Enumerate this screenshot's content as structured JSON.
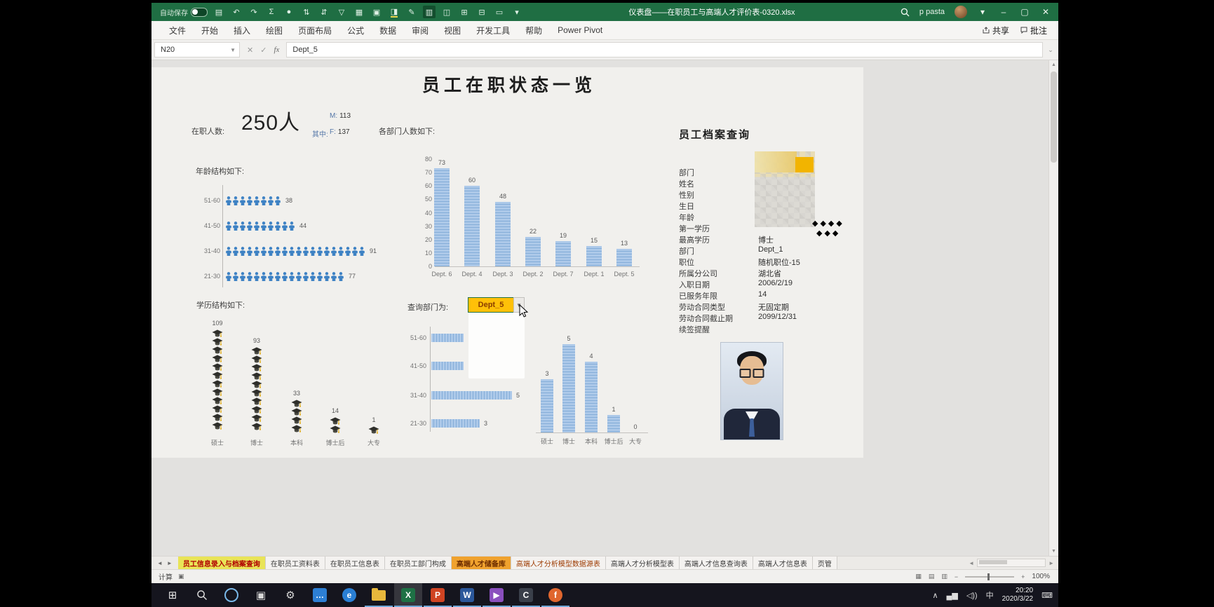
{
  "window": {
    "autosave_label": "自动保存",
    "title": "仪表盘——在职员工与高端人才评价表-0320.xlsx",
    "user": "p pasta",
    "minimize": "–",
    "maximize": "▢",
    "close": "✕",
    "qat_icons": [
      {
        "name": "save-icon",
        "glyph": "▤"
      },
      {
        "name": "undo-icon",
        "glyph": "↶"
      },
      {
        "name": "redo-icon",
        "glyph": "↷"
      },
      {
        "name": "autosum-icon",
        "glyph": "Σ"
      },
      {
        "name": "fill-circle-icon",
        "glyph": "●"
      },
      {
        "name": "sort-asc-icon",
        "glyph": "⇅"
      },
      {
        "name": "sort-desc-icon",
        "glyph": "⇵"
      },
      {
        "name": "filter-icon",
        "glyph": "▽"
      },
      {
        "name": "borders-icon",
        "glyph": "▦"
      },
      {
        "name": "merge-cells-icon",
        "glyph": "▣"
      },
      {
        "name": "fill-color-icon",
        "glyph": "◨"
      },
      {
        "name": "format-painter-icon",
        "glyph": "✎"
      },
      {
        "name": "gridlines-toggle-icon",
        "glyph": "▥",
        "active": true
      },
      {
        "name": "freeze-panes-icon",
        "glyph": "◫"
      },
      {
        "name": "new-window-icon",
        "glyph": "⊞"
      },
      {
        "name": "arrange-windows-icon",
        "glyph": "⊟"
      },
      {
        "name": "switch-window-icon",
        "glyph": "▭"
      },
      {
        "name": "qat-customize-icon",
        "glyph": "▾"
      }
    ]
  },
  "ribbon": {
    "tabs": [
      "文件",
      "开始",
      "插入",
      "绘图",
      "页面布局",
      "公式",
      "数据",
      "审阅",
      "视图",
      "开发工具",
      "帮助",
      "Power Pivot"
    ],
    "share_label": "共享",
    "comments_label": "批注"
  },
  "formula_bar": {
    "name_box": "N20",
    "cancel": "✕",
    "enter": "✓",
    "fx": "fx",
    "value": "Dept_5"
  },
  "dashboard": {
    "title": "员工在职状态一览",
    "headcount_label": "在职人数:",
    "headcount_value": "250人",
    "among_label": "其中:",
    "male_label": "M:",
    "male_value": "113",
    "female_label": "F:",
    "female_value": "137",
    "query_label": "查询部门为:",
    "query_value": "Dept_5",
    "profile": {
      "title": "员工档案查询",
      "fields": [
        {
          "label": "部门",
          "value": "",
          "masked": true
        },
        {
          "label": "姓名",
          "value": "",
          "masked": true
        },
        {
          "label": "性别",
          "value": "",
          "masked": true
        },
        {
          "label": "生日",
          "value": "",
          "masked": true
        },
        {
          "label": "年龄",
          "value": "",
          "masked": true
        },
        {
          "label": "第一学历",
          "value": "",
          "masked": true
        },
        {
          "label": "最高学历",
          "value": "博士",
          "masked": false
        },
        {
          "label": "部门",
          "value": "Dept_1",
          "masked": false
        },
        {
          "label": "职位",
          "value": "随机职位-15",
          "masked": false
        },
        {
          "label": "所属分公司",
          "value": "湖北省",
          "masked": false
        },
        {
          "label": "入职日期",
          "value": "2006/2/19",
          "masked": false
        },
        {
          "label": "已服务年限",
          "value": "14",
          "masked": false
        },
        {
          "label": "劳动合同类型",
          "value": "无固定期",
          "masked": false
        },
        {
          "label": "劳动合同截止期",
          "value": "2099/12/31",
          "masked": false
        },
        {
          "label": "续签提醒",
          "value": "",
          "masked": false
        }
      ]
    }
  },
  "chart_data": [
    {
      "id": "age_structure",
      "type": "pictogram-bar",
      "orientation": "horizontal",
      "title": "年龄结构如下:",
      "icon": "person-icon",
      "people_per_icon": 4.55,
      "categories": [
        "51-60",
        "41-50",
        "31-40",
        "21-30"
      ],
      "values": [
        38,
        44,
        91,
        77
      ],
      "color": "#3e82c4"
    },
    {
      "id": "dept_headcount",
      "type": "bar",
      "title": "各部门人数如下:",
      "categories": [
        "Dept. 6",
        "Dept. 4",
        "Dept. 3",
        "Dept. 2",
        "Dept. 7",
        "Dept. 1",
        "Dept. 5"
      ],
      "values": [
        73,
        60,
        48,
        22,
        19,
        15,
        13
      ],
      "ylim": [
        0,
        80
      ],
      "ytick_step": 10,
      "grid": false,
      "legend": false
    },
    {
      "id": "edu_structure",
      "type": "pictogram-column",
      "title": "学历结构如下:",
      "icon": "graduation-cap-icon",
      "units_per_icon": 9.3,
      "categories": [
        "硕士",
        "博士",
        "本科",
        "博士后",
        "大专"
      ],
      "values": [
        109,
        93,
        33,
        14,
        1
      ]
    },
    {
      "id": "query_dept_age",
      "type": "bar",
      "orientation": "horizontal",
      "categories": [
        "51-60",
        "41-50",
        "31-40",
        "21-30"
      ],
      "values": [
        2,
        2,
        5,
        3
      ],
      "value_labels_visible": [
        false,
        false,
        true,
        true
      ],
      "note": "values for 51-60 and 41-50 hidden behind white overlay"
    },
    {
      "id": "query_dept_edu",
      "type": "bar",
      "categories": [
        "硕士",
        "博士",
        "本科",
        "博士后",
        "大专"
      ],
      "values": [
        3,
        5,
        4,
        1,
        0
      ]
    }
  ],
  "decor": {
    "diamonds_row1": "◆◆◆◆",
    "diamonds_row2": "◆◆◆"
  },
  "sheet_tabs": {
    "nav_left": "◄",
    "nav_right": "►",
    "tabs": [
      {
        "label": "员工信息录入与档案查询",
        "style": "yellow"
      },
      {
        "label": "在职员工资料表",
        "style": ""
      },
      {
        "label": "在职员工信息表",
        "style": ""
      },
      {
        "label": "在职员工部门构成",
        "style": ""
      },
      {
        "label": "高端人才储备库",
        "style": "orange"
      },
      {
        "label": "高端人才分析模型数据源表",
        "style": "redtext"
      },
      {
        "label": "高端人才分析模型表",
        "style": ""
      },
      {
        "label": "高端人才信息查询表",
        "style": ""
      },
      {
        "label": "高端人才信息表",
        "style": ""
      },
      {
        "label": "页管",
        "style": ""
      }
    ]
  },
  "status_bar": {
    "mode": "计算",
    "zoom": "100%",
    "zoom_minus": "−",
    "zoom_plus": "+"
  },
  "taskbar": {
    "clock_time": "20:20",
    "clock_date": "2020/3/22",
    "tray_ime": "中",
    "icons": [
      {
        "name": "start-button",
        "kind": "glyph",
        "glyph": "⊞",
        "color": "#e8e8e8"
      },
      {
        "name": "search-icon",
        "kind": "search"
      },
      {
        "name": "cortana-icon",
        "kind": "ring",
        "color": "#7ab8e8"
      },
      {
        "name": "task-view-icon",
        "kind": "glyph",
        "glyph": "▣",
        "color": "#d8d8d8"
      },
      {
        "name": "settings-icon",
        "kind": "glyph",
        "glyph": "⚙",
        "color": "#d8d8d8"
      },
      {
        "name": "chat-icon",
        "kind": "sq",
        "glyph": "…",
        "bg": "#2d7fd4"
      },
      {
        "name": "edge-icon",
        "kind": "circ",
        "glyph": "e",
        "bg": "#2a7fd4"
      },
      {
        "name": "file-explorer-icon",
        "kind": "folder",
        "open": true
      },
      {
        "name": "excel-icon",
        "kind": "sq",
        "glyph": "X",
        "bg": "#1e7145",
        "open": true,
        "active": true
      },
      {
        "name": "powerpoint-icon",
        "kind": "sq",
        "glyph": "P",
        "bg": "#d04423",
        "open": true
      },
      {
        "name": "word-icon",
        "kind": "sq",
        "glyph": "W",
        "bg": "#2b579a",
        "open": true
      },
      {
        "name": "media-player-icon",
        "kind": "sq",
        "glyph": "▶",
        "bg": "#8a4fbe",
        "open": true
      },
      {
        "name": "c-app-icon",
        "kind": "sq",
        "glyph": "C",
        "bg": "#3a3f4a",
        "open": true
      },
      {
        "name": "firefox-icon",
        "kind": "circ",
        "glyph": "f",
        "bg": "#e0662e",
        "open": true
      }
    ]
  }
}
